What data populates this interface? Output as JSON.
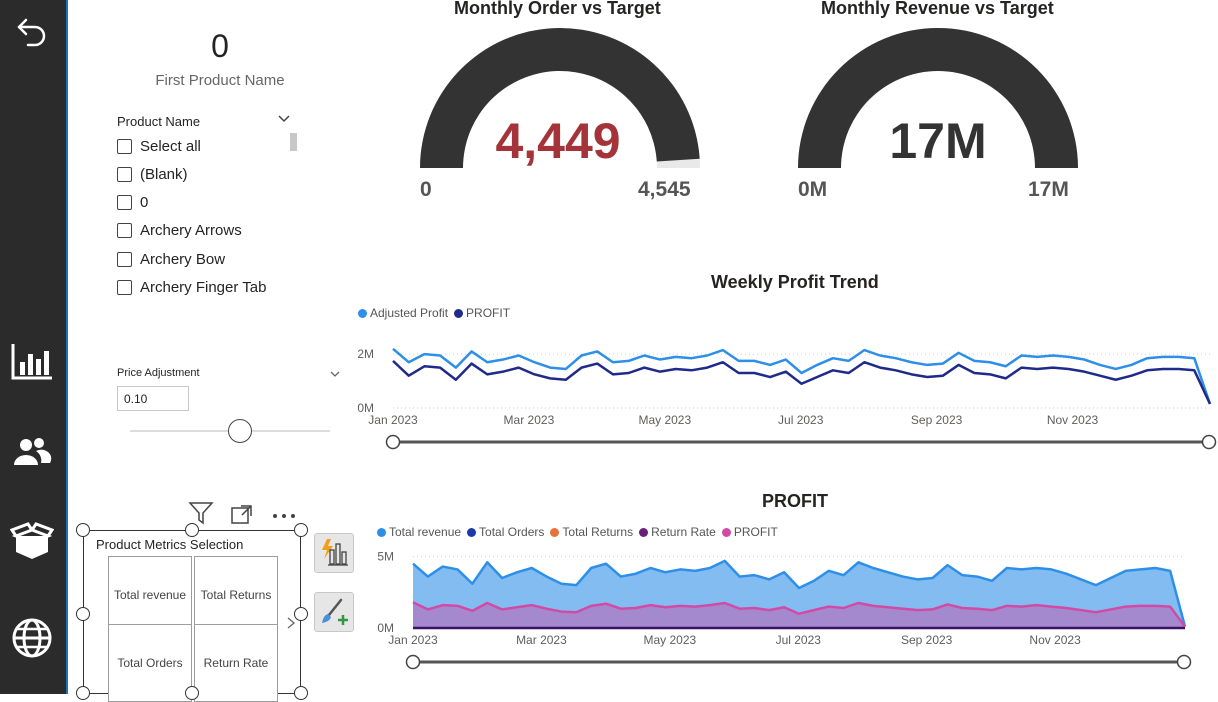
{
  "card": {
    "value": "0",
    "label": "First Product Name"
  },
  "slicer": {
    "title": "Product Name",
    "items": [
      "Select all",
      "(Blank)",
      "0",
      "Archery Arrows",
      "Archery Bow",
      "Archery Finger Tab"
    ]
  },
  "price_adjustment": {
    "label": "Price Adjustment",
    "value": "0.10",
    "slider_fraction": 0.55
  },
  "gauges": [
    {
      "title": "Monthly Order vs Target",
      "value_label": "4,449",
      "min_label": "0",
      "max_label": "4,545",
      "value": 4449,
      "min": 0,
      "max": 4545,
      "value_color": "#a4343a"
    },
    {
      "title": "Monthly Revenue vs Target",
      "value_label": "17M",
      "min_label": "0M",
      "max_label": "17M",
      "value": 17,
      "min": 0,
      "max": 17,
      "value_color": "#333333"
    }
  ],
  "matrix": {
    "title": "Product Metrics Selection",
    "cells": [
      "Total revenue",
      "Total Returns",
      "Total Orders",
      "Return Rate"
    ]
  },
  "colors": {
    "sidebar": "#2b2b2b",
    "adjusted_profit": "#2e8fe8",
    "profit_dark": "#1f2a8a",
    "revenue_fill": "#7db8f5",
    "profit_pink": "#d14ba6",
    "gauge": "#333333"
  },
  "icons": {
    "back": "back-arrow-icon",
    "report": "bar-chart-icon",
    "people": "people-icon",
    "box": "box-icon",
    "globe": "globe-icon"
  },
  "chart_data": [
    {
      "type": "line",
      "title": "Weekly Profit Trend",
      "series": [
        {
          "name": "Adjusted Profit",
          "color": "#2e8fe8",
          "values": [
            2.2,
            1.7,
            2.0,
            1.95,
            1.5,
            2.1,
            1.7,
            1.8,
            1.95,
            1.7,
            1.5,
            1.45,
            1.95,
            2.1,
            1.7,
            1.75,
            1.95,
            1.8,
            1.9,
            1.85,
            1.95,
            2.15,
            1.75,
            1.75,
            1.6,
            1.8,
            1.3,
            1.6,
            1.85,
            1.75,
            2.15,
            1.95,
            1.85,
            1.7,
            1.6,
            1.65,
            2.05,
            1.75,
            1.7,
            1.55,
            1.95,
            1.9,
            1.95,
            1.9,
            1.8,
            1.6,
            1.45,
            1.6,
            1.85,
            1.9,
            1.9,
            1.85,
            0.15
          ]
        },
        {
          "name": "PROFIT",
          "color": "#1f2a8a",
          "values": [
            1.75,
            1.2,
            1.55,
            1.5,
            1.05,
            1.65,
            1.25,
            1.35,
            1.5,
            1.25,
            1.1,
            1.05,
            1.5,
            1.65,
            1.25,
            1.3,
            1.5,
            1.35,
            1.45,
            1.4,
            1.5,
            1.7,
            1.3,
            1.3,
            1.15,
            1.35,
            0.9,
            1.15,
            1.4,
            1.3,
            1.7,
            1.5,
            1.4,
            1.25,
            1.15,
            1.2,
            1.6,
            1.3,
            1.25,
            1.1,
            1.5,
            1.45,
            1.5,
            1.45,
            1.35,
            1.2,
            1.05,
            1.2,
            1.4,
            1.45,
            1.45,
            1.4,
            0.15
          ]
        }
      ],
      "x_labels": [
        "Jan 2023",
        "Mar 2023",
        "May 2023",
        "Jul 2023",
        "Sep 2023",
        "Nov 2023"
      ],
      "y_ticks": [
        "0M",
        "2M"
      ],
      "ylim": [
        0,
        2.6
      ]
    },
    {
      "type": "area",
      "title": "PROFIT",
      "legend": [
        "Total revenue",
        "Total Orders",
        "Total Returns",
        "Return Rate",
        "PROFIT"
      ],
      "legend_colors": [
        "#2e8fe8",
        "#1f3aa8",
        "#e8703a",
        "#6b1f7a",
        "#d14ba6"
      ],
      "series": [
        {
          "name": "Total revenue",
          "color": "#2e8fe8",
          "values": [
            4.5,
            3.6,
            4.3,
            4.1,
            3.1,
            4.6,
            3.5,
            3.9,
            4.2,
            3.6,
            3.1,
            3.0,
            4.2,
            4.5,
            3.6,
            3.8,
            4.2,
            3.9,
            4.1,
            4.0,
            4.2,
            4.7,
            3.6,
            3.7,
            3.4,
            3.9,
            2.8,
            3.3,
            4.0,
            3.7,
            4.6,
            4.2,
            3.9,
            3.6,
            3.4,
            3.5,
            4.4,
            3.7,
            3.6,
            3.3,
            4.2,
            4.1,
            4.2,
            4.1,
            3.8,
            3.4,
            3.0,
            3.5,
            4.0,
            4.1,
            4.2,
            4.0,
            0.1
          ]
        },
        {
          "name": "PROFIT",
          "color": "#d14ba6",
          "values": [
            1.8,
            1.3,
            1.6,
            1.55,
            1.2,
            1.75,
            1.3,
            1.45,
            1.6,
            1.35,
            1.15,
            1.1,
            1.55,
            1.7,
            1.35,
            1.4,
            1.6,
            1.45,
            1.55,
            1.5,
            1.6,
            1.75,
            1.35,
            1.4,
            1.25,
            1.45,
            1.0,
            1.25,
            1.5,
            1.4,
            1.75,
            1.55,
            1.45,
            1.35,
            1.25,
            1.3,
            1.65,
            1.4,
            1.35,
            1.25,
            1.55,
            1.5,
            1.6,
            1.5,
            1.4,
            1.25,
            1.1,
            1.3,
            1.5,
            1.55,
            1.55,
            1.5,
            0.1
          ]
        }
      ],
      "x_labels": [
        "Jan 2023",
        "Mar 2023",
        "May 2023",
        "Jul 2023",
        "Sep 2023",
        "Nov 2023"
      ],
      "y_ticks": [
        "0M",
        "5M"
      ],
      "ylim": [
        0,
        5.6
      ]
    }
  ]
}
